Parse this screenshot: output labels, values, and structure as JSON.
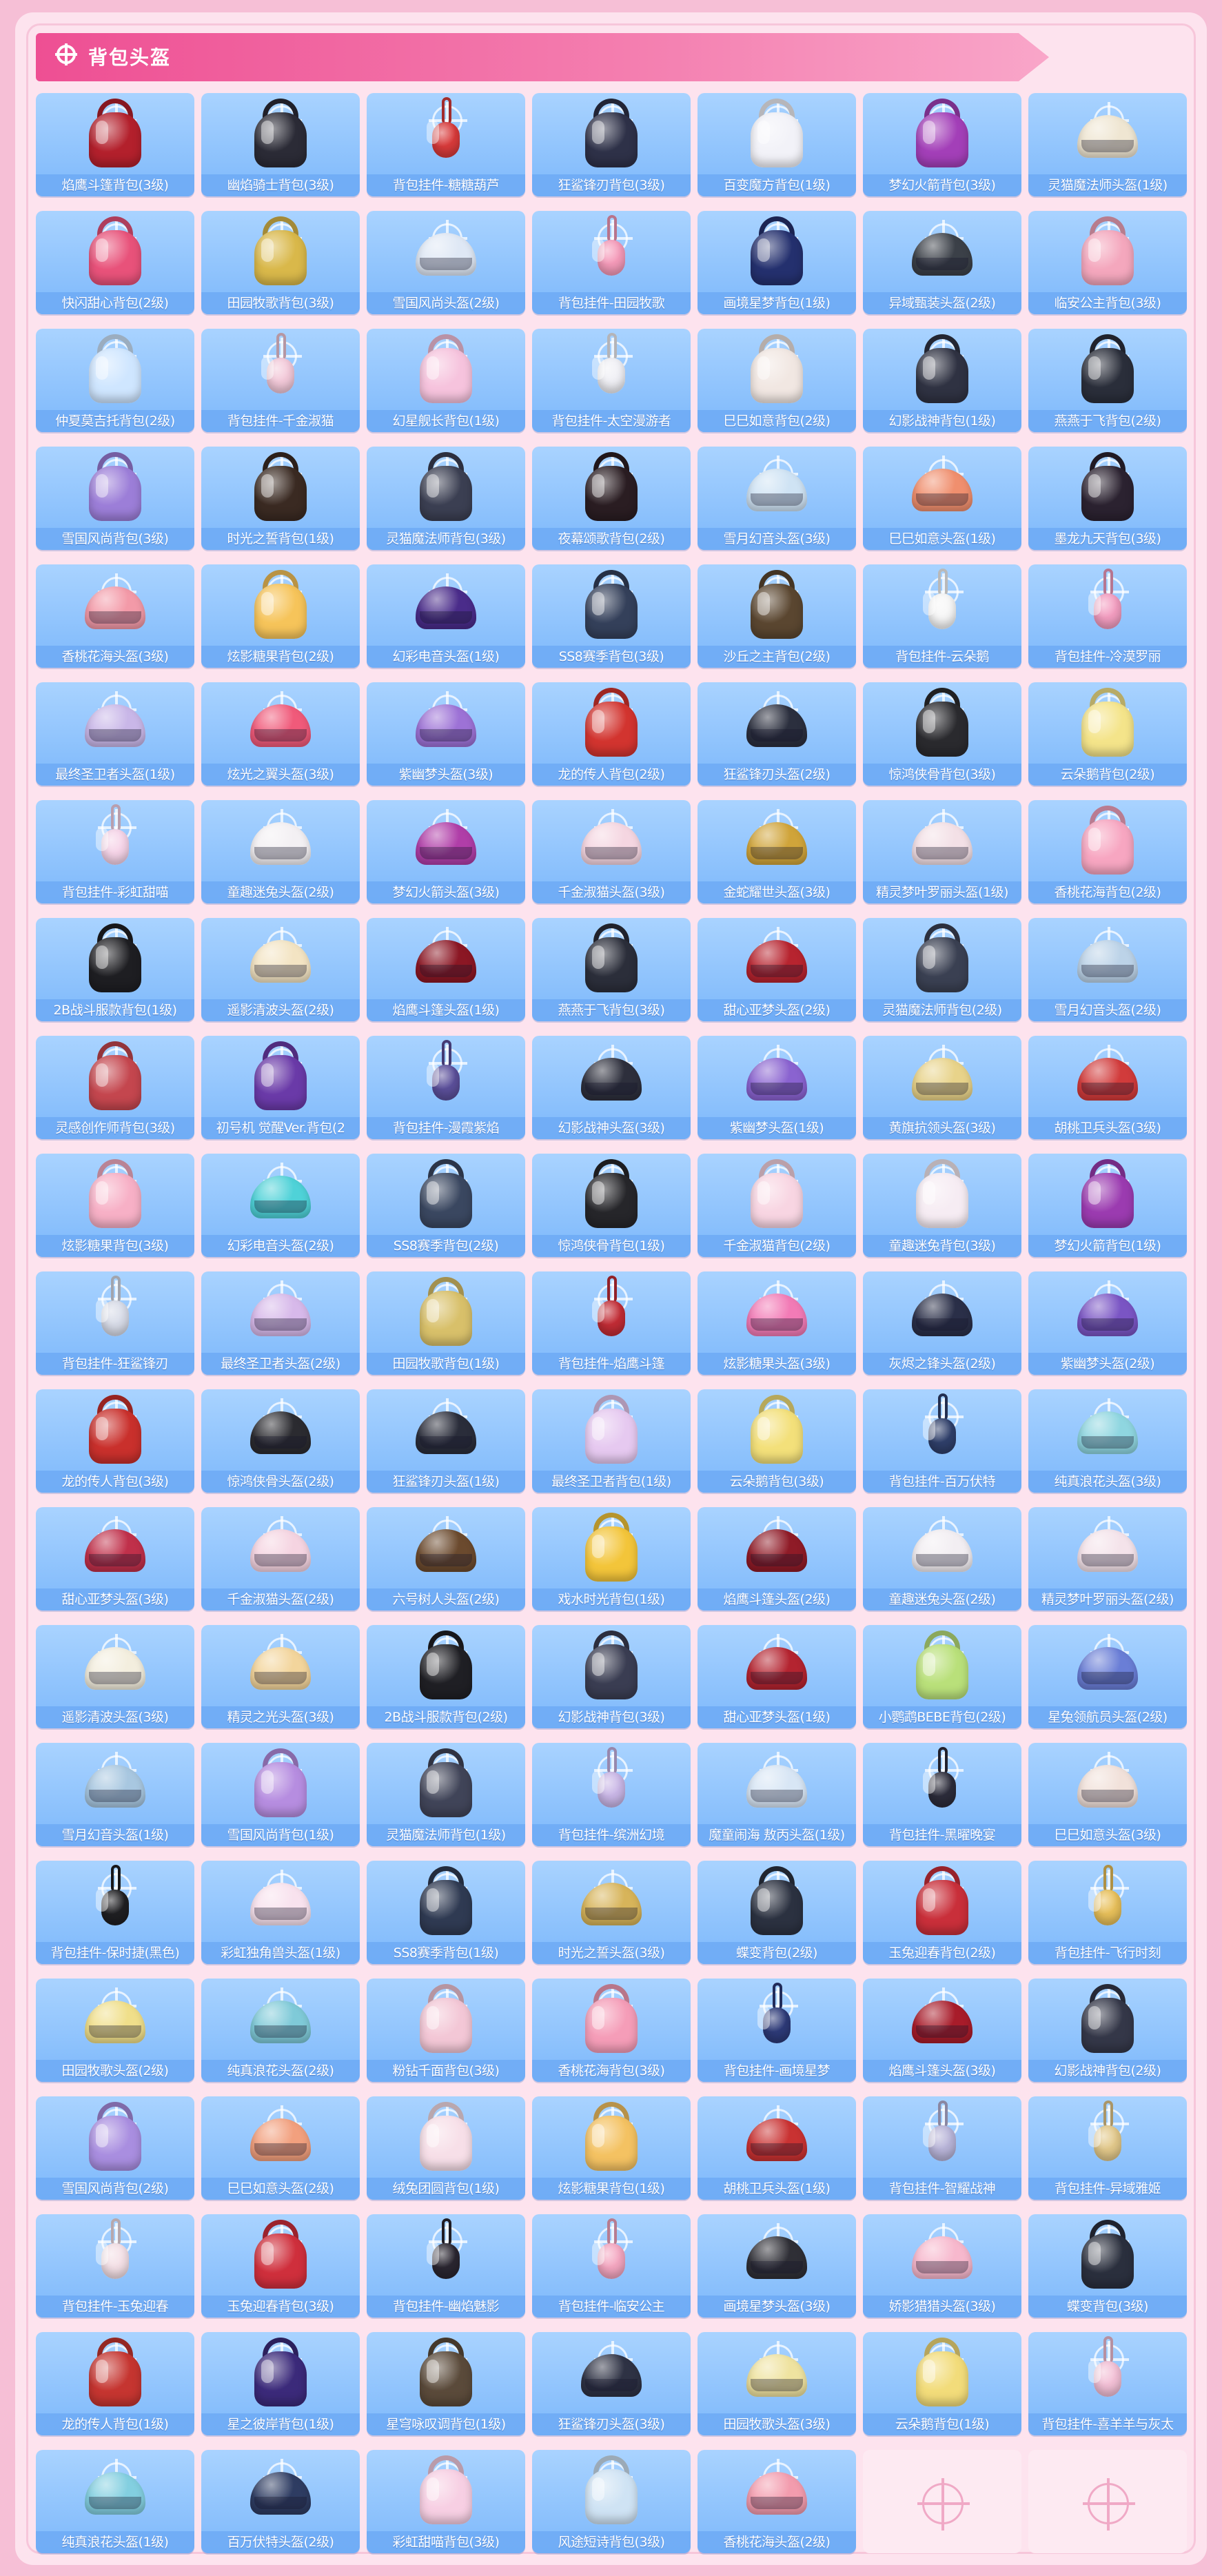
{
  "section": {
    "title": "背包头盔"
  },
  "items": [
    {
      "name": "焰鹰斗篷背包(3级)",
      "color": "#b3202c",
      "kind": "bag"
    },
    {
      "name": "幽焰骑士背包(3级)",
      "color": "#2b2b36",
      "kind": "bag"
    },
    {
      "name": "背包挂件-糖糖葫芦",
      "color": "#d83a3a",
      "kind": "charm"
    },
    {
      "name": "狂鲨锋刃背包(3级)",
      "color": "#2e3148",
      "kind": "bag"
    },
    {
      "name": "百变魔方背包(1级)",
      "color": "#f2f2f8",
      "kind": "bag"
    },
    {
      "name": "梦幻火箭背包(3级)",
      "color": "#a33fb8",
      "kind": "bag"
    },
    {
      "name": "灵猫魔法师头盔(1级)",
      "color": "#efe6d2",
      "kind": "helmet"
    },
    {
      "name": "快闪甜心背包(2级)",
      "color": "#e8527a",
      "kind": "bag"
    },
    {
      "name": "田园牧歌背包(3级)",
      "color": "#d9b84a",
      "kind": "bag"
    },
    {
      "name": "雪国风尚头盔(2级)",
      "color": "#dfe8f5",
      "kind": "helmet"
    },
    {
      "name": "背包挂件-田园牧歌",
      "color": "#f59ab9",
      "kind": "charm"
    },
    {
      "name": "画境星梦背包(1级)",
      "color": "#24306e",
      "kind": "bag"
    },
    {
      "name": "异域甄装头盔(2级)",
      "color": "#3b4048",
      "kind": "helmet"
    },
    {
      "name": "临安公主背包(3级)",
      "color": "#f4a7bd",
      "kind": "bag"
    },
    {
      "name": "仲夏莫吉托背包(2级)",
      "color": "#cfe6ff",
      "kind": "bag"
    },
    {
      "name": "背包挂件-千金淑猫",
      "color": "#f3c9d9",
      "kind": "charm"
    },
    {
      "name": "幻星舰长背包(1级)",
      "color": "#f6c3dd",
      "kind": "bag"
    },
    {
      "name": "背包挂件-太空漫游者",
      "color": "#f0f0f5",
      "kind": "charm"
    },
    {
      "name": "巳巳如意背包(2级)",
      "color": "#f1e7e2",
      "kind": "bag"
    },
    {
      "name": "幻影战神背包(1级)",
      "color": "#2f3242",
      "kind": "bag"
    },
    {
      "name": "燕燕于飞背包(2级)",
      "color": "#2a2e3a",
      "kind": "bag"
    },
    {
      "name": "雪国风尚背包(3级)",
      "color": "#9c7ed8",
      "kind": "bag"
    },
    {
      "name": "时光之誓背包(1级)",
      "color": "#3a2a22",
      "kind": "bag"
    },
    {
      "name": "灵猫魔法师背包(3级)",
      "color": "#3b3f52",
      "kind": "bag"
    },
    {
      "name": "夜幕颂歌背包(2级)",
      "color": "#2a1d22",
      "kind": "bag"
    },
    {
      "name": "雪月幻音头盔(3级)",
      "color": "#cfe3f4",
      "kind": "helmet"
    },
    {
      "name": "巳巳如意头盔(1级)",
      "color": "#f08f6e",
      "kind": "helmet"
    },
    {
      "name": "墨龙九天背包(3级)",
      "color": "#2b2230",
      "kind": "bag"
    },
    {
      "name": "香桃花海头盔(3级)",
      "color": "#f39aa8",
      "kind": "helmet"
    },
    {
      "name": "炫影糖果背包(2级)",
      "color": "#f6c45a",
      "kind": "bag"
    },
    {
      "name": "幻彩电音头盔(1级)",
      "color": "#4a2c8a",
      "kind": "helmet"
    },
    {
      "name": "SS8赛季背包(3级)",
      "color": "#34405a",
      "kind": "bag"
    },
    {
      "name": "沙丘之主背包(2级)",
      "color": "#5a4630",
      "kind": "bag"
    },
    {
      "name": "背包挂件-云朵鹅",
      "color": "#f7f7f7",
      "kind": "charm"
    },
    {
      "name": "背包挂件-冷漠罗丽",
      "color": "#f39dc0",
      "kind": "charm"
    },
    {
      "name": "最终圣卫者头盔(1级)",
      "color": "#c9b7e8",
      "kind": "helmet"
    },
    {
      "name": "炫光之翼头盔(3级)",
      "color": "#f05a7a",
      "kind": "helmet"
    },
    {
      "name": "紫幽梦头盔(3级)",
      "color": "#9d72d6",
      "kind": "helmet"
    },
    {
      "name": "龙的传人背包(2级)",
      "color": "#d2342f",
      "kind": "bag"
    },
    {
      "name": "狂鲨锋刃头盔(2级)",
      "color": "#2b2f3e",
      "kind": "helmet"
    },
    {
      "name": "惊鸿侠骨背包(3级)",
      "color": "#2a2a2e",
      "kind": "bag"
    },
    {
      "name": "云朵鹅背包(2级)",
      "color": "#f4e48a",
      "kind": "bag"
    },
    {
      "name": "背包挂件-彩虹甜喵",
      "color": "#f6d4e8",
      "kind": "charm"
    },
    {
      "name": "童趣迷兔头盔(2级)",
      "color": "#f3f0f3",
      "kind": "helmet"
    },
    {
      "name": "梦幻火箭头盔(3级)",
      "color": "#b03ea8",
      "kind": "helmet"
    },
    {
      "name": "千金淑猫头盔(3级)",
      "color": "#f5d6e1",
      "kind": "helmet"
    },
    {
      "name": "金蛇耀世头盔(3级)",
      "color": "#d0a43a",
      "kind": "helmet"
    },
    {
      "name": "精灵梦叶罗丽头盔(1级)",
      "color": "#f3e0e6",
      "kind": "helmet"
    },
    {
      "name": "香桃花海背包(2级)",
      "color": "#f7a6c1",
      "kind": "bag"
    },
    {
      "name": "2B战斗服款背包(1级)",
      "color": "#1e1e22",
      "kind": "bag"
    },
    {
      "name": "遥影清波头盔(2级)",
      "color": "#f3e4c3",
      "kind": "helmet"
    },
    {
      "name": "焰鹰斗篷头盔(1级)",
      "color": "#8b1724",
      "kind": "helmet"
    },
    {
      "name": "燕燕于飞背包(3级)",
      "color": "#2b2e3a",
      "kind": "bag"
    },
    {
      "name": "甜心亚梦头盔(2级)",
      "color": "#b7242f",
      "kind": "helmet"
    },
    {
      "name": "灵猫魔法师背包(2级)",
      "color": "#3a4052",
      "kind": "bag"
    },
    {
      "name": "雪月幻音头盔(2级)",
      "color": "#bcd3e8",
      "kind": "helmet"
    },
    {
      "name": "灵感创作师背包(3级)",
      "color": "#c4464e",
      "kind": "bag"
    },
    {
      "name": "初号机 觉醒Ver.背包(2",
      "color": "#6a3aa8",
      "kind": "bag"
    },
    {
      "name": "背包挂件-漫霞紫焰",
      "color": "#5b4f9a",
      "kind": "charm"
    },
    {
      "name": "幻影战神头盔(3级)",
      "color": "#2d2f3c",
      "kind": "helmet"
    },
    {
      "name": "紫幽梦头盔(1级)",
      "color": "#8a63d0",
      "kind": "helmet"
    },
    {
      "name": "黄旗抗领头盔(3级)",
      "color": "#e8d38a",
      "kind": "helmet"
    },
    {
      "name": "胡桃卫兵头盔(3级)",
      "color": "#d13b3b",
      "kind": "helmet"
    },
    {
      "name": "炫影糖果背包(3级)",
      "color": "#f7b0c6",
      "kind": "bag"
    },
    {
      "name": "幻彩电音头盔(2级)",
      "color": "#4fd2d8",
      "kind": "helmet"
    },
    {
      "name": "SS8赛季背包(2级)",
      "color": "#3a4760",
      "kind": "bag"
    },
    {
      "name": "惊鸿侠骨背包(1级)",
      "color": "#26262a",
      "kind": "bag"
    },
    {
      "name": "千金淑猫背包(2级)",
      "color": "#f8d5e2",
      "kind": "bag"
    },
    {
      "name": "童趣迷兔背包(3级)",
      "color": "#f6ecf3",
      "kind": "bag"
    },
    {
      "name": "梦幻火箭背包(1级)",
      "color": "#9b3bb0",
      "kind": "bag"
    },
    {
      "name": "背包挂件-狂鲨锋刃",
      "color": "#d8dce8",
      "kind": "charm"
    },
    {
      "name": "最终圣卫者头盔(2级)",
      "color": "#d7b9ea",
      "kind": "helmet"
    },
    {
      "name": "田园牧歌背包(1级)",
      "color": "#d8c06a",
      "kind": "bag"
    },
    {
      "name": "背包挂件-焰鹰斗篷",
      "color": "#c22c35",
      "kind": "charm"
    },
    {
      "name": "炫影糖果头盔(3级)",
      "color": "#f27bb6",
      "kind": "helmet"
    },
    {
      "name": "灰烬之锋头盔(2级)",
      "color": "#2a2f48",
      "kind": "helmet"
    },
    {
      "name": "紫幽梦头盔(2级)",
      "color": "#7a55c4",
      "kind": "helmet"
    },
    {
      "name": "龙的传人背包(3级)",
      "color": "#c9302c",
      "kind": "bag"
    },
    {
      "name": "惊鸿侠骨头盔(2级)",
      "color": "#2b2b30",
      "kind": "helmet"
    },
    {
      "name": "狂鲨锋刃头盔(1级)",
      "color": "#2a2d3a",
      "kind": "helmet"
    },
    {
      "name": "最终圣卫者背包(1级)",
      "color": "#e6c9f0",
      "kind": "bag"
    },
    {
      "name": "云朵鹅背包(3级)",
      "color": "#f3e07a",
      "kind": "bag"
    },
    {
      "name": "背包挂件-百万伏特",
      "color": "#2f3f6a",
      "kind": "charm"
    },
    {
      "name": "纯真浪花头盔(3级)",
      "color": "#8fd6e0",
      "kind": "helmet"
    },
    {
      "name": "甜心亚梦头盔(3级)",
      "color": "#c0304a",
      "kind": "helmet"
    },
    {
      "name": "千金淑猫头盔(2级)",
      "color": "#f5d4e1",
      "kind": "helmet"
    },
    {
      "name": "六号树人头盔(2级)",
      "color": "#6b4a2e",
      "kind": "helmet"
    },
    {
      "name": "戏水时光背包(1级)",
      "color": "#f3c53a",
      "kind": "bag"
    },
    {
      "name": "焰鹰斗篷头盔(2级)",
      "color": "#8f1b27",
      "kind": "helmet"
    },
    {
      "name": "童趣迷兔头盔(2级)",
      "color": "#f2eef2",
      "kind": "helmet"
    },
    {
      "name": "精灵梦叶罗丽头盔(2级)",
      "color": "#f4e3ea",
      "kind": "helmet"
    },
    {
      "name": "遥影清波头盔(3级)",
      "color": "#f3eede",
      "kind": "helmet"
    },
    {
      "name": "精灵之光头盔(3级)",
      "color": "#f3d59c",
      "kind": "helmet"
    },
    {
      "name": "2B战斗服款背包(2级)",
      "color": "#1f1f24",
      "kind": "bag"
    },
    {
      "name": "幻影战神背包(3级)",
      "color": "#3a3d52",
      "kind": "bag"
    },
    {
      "name": "甜心亚梦头盔(1级)",
      "color": "#b42430",
      "kind": "helmet"
    },
    {
      "name": "小鹦鹉BEBE背包(2级)",
      "color": "#b9e07a",
      "kind": "bag"
    },
    {
      "name": "星兔领航员头盔(2级)",
      "color": "#6a7ed6",
      "kind": "helmet"
    },
    {
      "name": "雪月幻音头盔(1级)",
      "color": "#a8c7e0",
      "kind": "helmet"
    },
    {
      "name": "雪国风尚背包(1级)",
      "color": "#b68de0",
      "kind": "bag"
    },
    {
      "name": "灵猫魔法师背包(1级)",
      "color": "#404458",
      "kind": "bag"
    },
    {
      "name": "背包挂件-缤洲幻境",
      "color": "#c9b6e6",
      "kind": "charm"
    },
    {
      "name": "魔童闹海 敖丙头盔(1级)",
      "color": "#d8e6f5",
      "kind": "helmet"
    },
    {
      "name": "背包挂件-黑曜晚宴",
      "color": "#2c2c3a",
      "kind": "charm"
    },
    {
      "name": "巳巳如意头盔(3级)",
      "color": "#f1e1da",
      "kind": "helmet"
    },
    {
      "name": "背包挂件-保时捷(黑色)",
      "color": "#1f1f22",
      "kind": "charm"
    },
    {
      "name": "彩虹独角兽头盔(1级)",
      "color": "#f8e2ee",
      "kind": "helmet"
    },
    {
      "name": "SS8赛季背包(1级)",
      "color": "#2f3a52",
      "kind": "bag"
    },
    {
      "name": "时光之誓头盔(3级)",
      "color": "#d7b45a",
      "kind": "helmet"
    },
    {
      "name": "蝶变背包(2级)",
      "color": "#2b3140",
      "kind": "bag"
    },
    {
      "name": "玉兔迎春背包(2级)",
      "color": "#c92f3a",
      "kind": "bag"
    },
    {
      "name": "背包挂件-飞行时刻",
      "color": "#e8c05a",
      "kind": "charm"
    },
    {
      "name": "田园牧歌头盔(2级)",
      "color": "#f0df8a",
      "kind": "helmet"
    },
    {
      "name": "纯真浪花头盔(2级)",
      "color": "#7fcad8",
      "kind": "helmet"
    },
    {
      "name": "粉钻千面背包(3级)",
      "color": "#f3c7d6",
      "kind": "bag"
    },
    {
      "name": "香桃花海背包(3级)",
      "color": "#f59db8",
      "kind": "bag"
    },
    {
      "name": "背包挂件-画境星梦",
      "color": "#2d3a78",
      "kind": "charm"
    },
    {
      "name": "焰鹰斗篷头盔(3级)",
      "color": "#a81c2a",
      "kind": "helmet"
    },
    {
      "name": "幻影战神背包(2级)",
      "color": "#343748",
      "kind": "bag"
    },
    {
      "name": "雪国风尚背包(2级)",
      "color": "#a98ee0",
      "kind": "bag"
    },
    {
      "name": "巳巳如意头盔(2级)",
      "color": "#f2a07e",
      "kind": "helmet"
    },
    {
      "name": "绒兔团圆背包(1级)",
      "color": "#f7dfe8",
      "kind": "bag"
    },
    {
      "name": "炫影糖果背包(1级)",
      "color": "#f4c262",
      "kind": "bag"
    },
    {
      "name": "胡桃卫兵头盔(1级)",
      "color": "#c93232",
      "kind": "helmet"
    },
    {
      "name": "背包挂件-智耀战神",
      "color": "#b8b4d8",
      "kind": "charm"
    },
    {
      "name": "背包挂件-异域雅姬",
      "color": "#e2c88a",
      "kind": "charm"
    },
    {
      "name": "背包挂件-玉兔迎春",
      "color": "#f4e0e6",
      "kind": "charm"
    },
    {
      "name": "玉兔迎春背包(3级)",
      "color": "#cf2f3c",
      "kind": "bag"
    },
    {
      "name": "背包挂件-幽焰魅影",
      "color": "#2a2630",
      "kind": "charm"
    },
    {
      "name": "背包挂件-临安公主",
      "color": "#f4a6c0",
      "kind": "charm"
    },
    {
      "name": "画境星梦头盔(3级)",
      "color": "#2f2f36",
      "kind": "helmet"
    },
    {
      "name": "娇影猎猎头盔(3级)",
      "color": "#f7b8cd",
      "kind": "helmet"
    },
    {
      "name": "蝶变背包(3级)",
      "color": "#2a2f3d",
      "kind": "bag"
    },
    {
      "name": "龙的传人背包(1级)",
      "color": "#c53530",
      "kind": "bag"
    },
    {
      "name": "星之彼岸背包(1级)",
      "color": "#3b2a7a",
      "kind": "bag"
    },
    {
      "name": "星穹咏叹调背包(1级)",
      "color": "#5a4a3a",
      "kind": "bag"
    },
    {
      "name": "狂鲨锋刃头盔(3级)",
      "color": "#2e3244",
      "kind": "helmet"
    },
    {
      "name": "田园牧歌头盔(3级)",
      "color": "#efe3a0",
      "kind": "helmet"
    },
    {
      "name": "云朵鹅背包(1级)",
      "color": "#f2dc7a",
      "kind": "bag"
    },
    {
      "name": "背包挂件-喜羊羊与灰太",
      "color": "#f3c0d6",
      "kind": "charm"
    },
    {
      "name": "纯真浪花头盔(1级)",
      "color": "#83cfe0",
      "kind": "helmet"
    },
    {
      "name": "百万伏特头盔(2级)",
      "color": "#2e3c62",
      "kind": "helmet"
    },
    {
      "name": "彩虹甜喵背包(3级)",
      "color": "#f7cfe3",
      "kind": "bag"
    },
    {
      "name": "风途短诗背包(3级)",
      "color": "#cfe3f4",
      "kind": "bag"
    },
    {
      "name": "香桃花海头盔(2级)",
      "color": "#f39cae",
      "kind": "helmet"
    }
  ]
}
